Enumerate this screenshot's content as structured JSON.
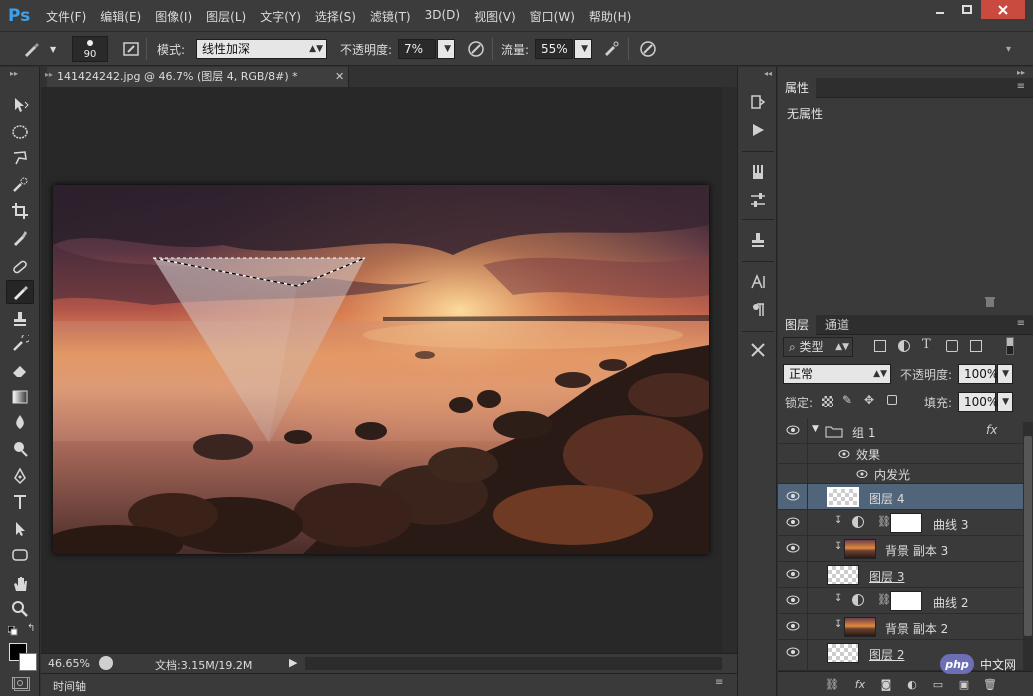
{
  "app": {
    "logo": "Ps"
  },
  "menu": [
    "文件(F)",
    "编辑(E)",
    "图像(I)",
    "图层(L)",
    "文字(Y)",
    "选择(S)",
    "滤镜(T)",
    "3D(D)",
    "视图(V)",
    "窗口(W)",
    "帮助(H)"
  ],
  "options": {
    "brush_size": "90",
    "mode_label": "模式:",
    "mode_value": "线性加深",
    "opacity_label": "不透明度:",
    "opacity_value": "7%",
    "flow_label": "流量:",
    "flow_value": "55%"
  },
  "document": {
    "tab_title": "141424242.jpg @ 46.7% (图层 4, RGB/8#) *",
    "zoom": "46.65%",
    "doc_info": "文档:3.15M/19.2M"
  },
  "timeline": {
    "label": "时间轴"
  },
  "properties": {
    "tab": "属性",
    "empty_text": "无属性"
  },
  "layers_panel": {
    "tabs": [
      "图层",
      "通道"
    ],
    "filter_kind": "类型",
    "blend_mode": "正常",
    "opacity_label": "不透明度:",
    "opacity_value": "100%",
    "lock_label": "锁定:",
    "fill_label": "填充:",
    "fill_value": "100%",
    "layers": [
      {
        "name": "组 1",
        "fx": "fx"
      },
      {
        "name": "效果"
      },
      {
        "name": "内发光"
      },
      {
        "name": "图层 4"
      },
      {
        "name": "曲线 3"
      },
      {
        "name": "背景 副本 3"
      },
      {
        "name": "图层 3"
      },
      {
        "name": "曲线 2"
      },
      {
        "name": "背景 副本 2"
      },
      {
        "name": "图层 2"
      }
    ]
  },
  "watermark": {
    "logo": "php",
    "text": "中文网"
  },
  "colors": {
    "accent": "#3ea0ea",
    "selected_layer": "#50647a",
    "close": "#c94a3f"
  }
}
